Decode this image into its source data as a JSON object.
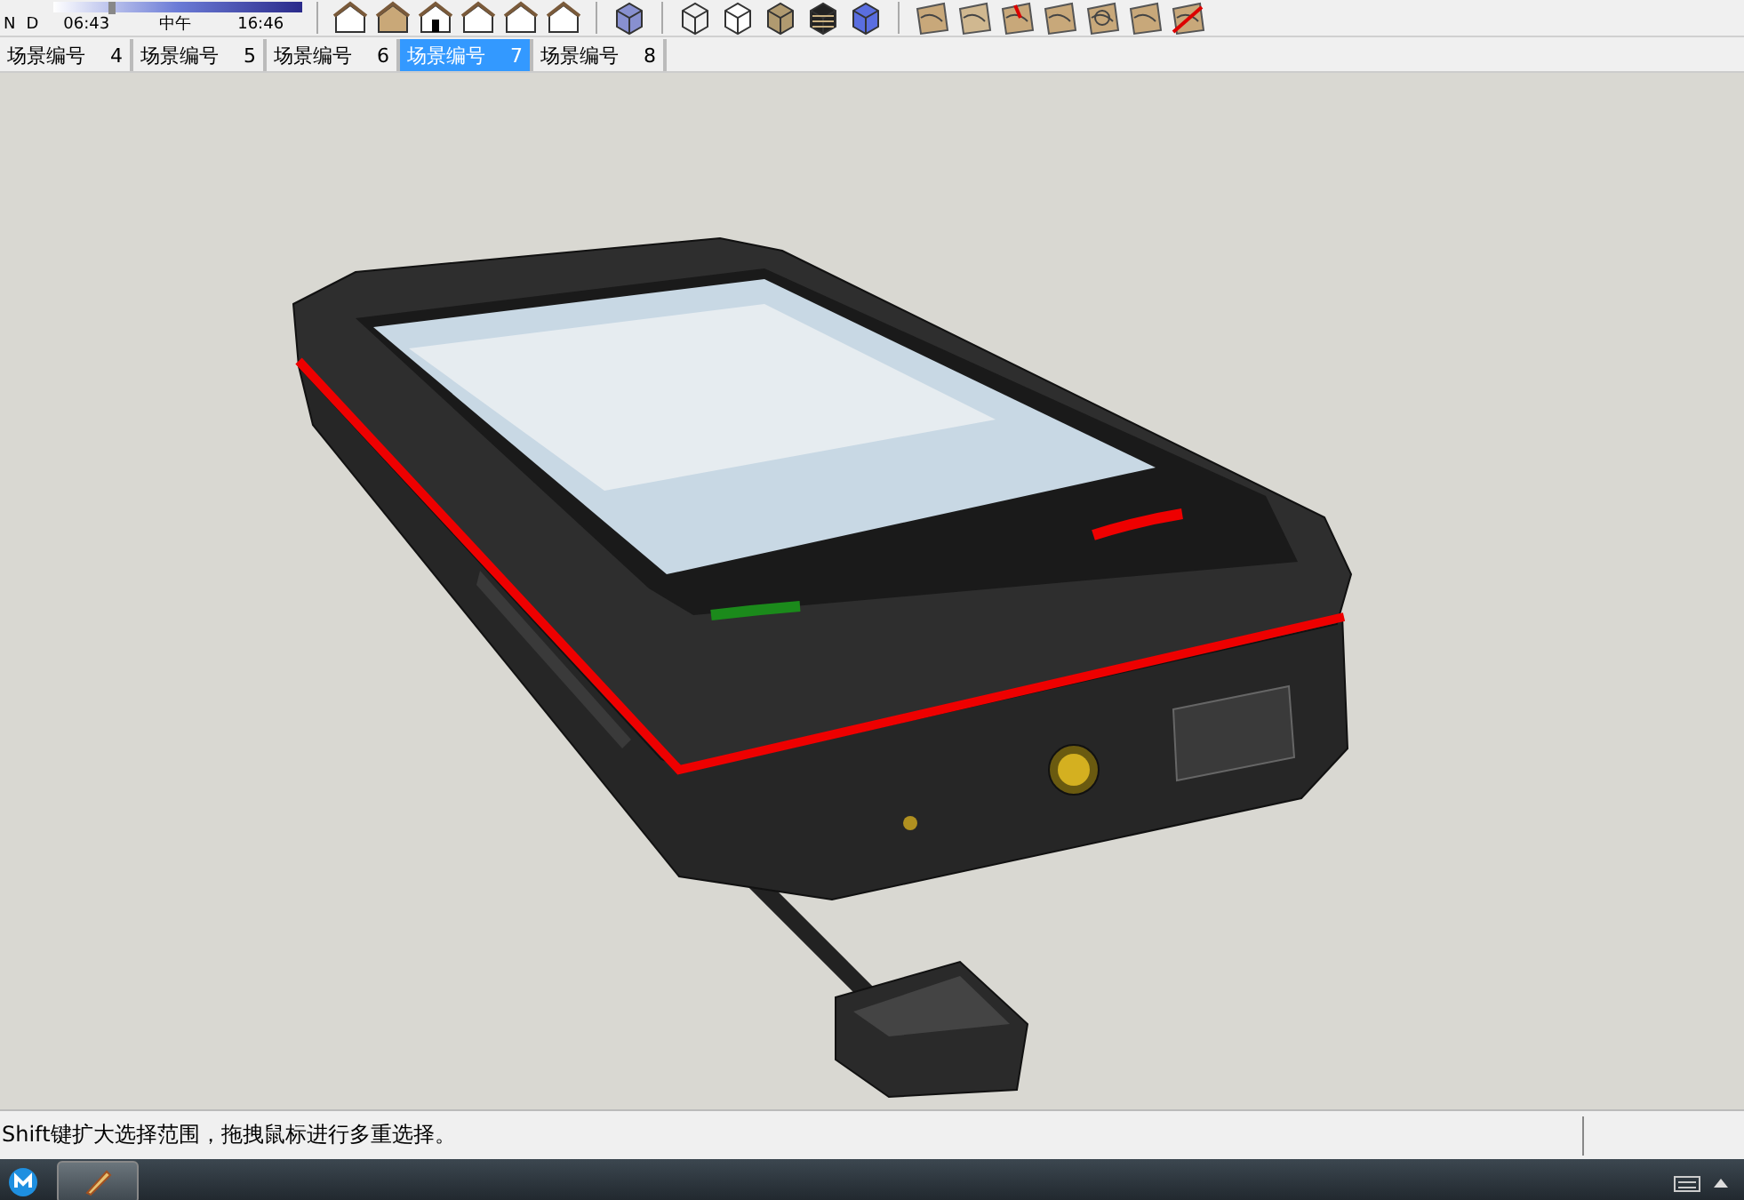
{
  "time_slider": {
    "left_mark": "N",
    "right_mark": "D",
    "start": "06:43",
    "middle": "中午",
    "end": "16:46",
    "level": 0.22
  },
  "scene_tabs": [
    {
      "label": "场景编号",
      "number": "4",
      "selected": false
    },
    {
      "label": "场景编号",
      "number": "5",
      "selected": false
    },
    {
      "label": "场景编号",
      "number": "6",
      "selected": false
    },
    {
      "label": "场景编号",
      "number": "7",
      "selected": true
    },
    {
      "label": "场景编号",
      "number": "8",
      "selected": false
    }
  ],
  "status_bar": {
    "message": "Shift键扩大选择范围，拖拽鼠标进行多重选择。"
  }
}
